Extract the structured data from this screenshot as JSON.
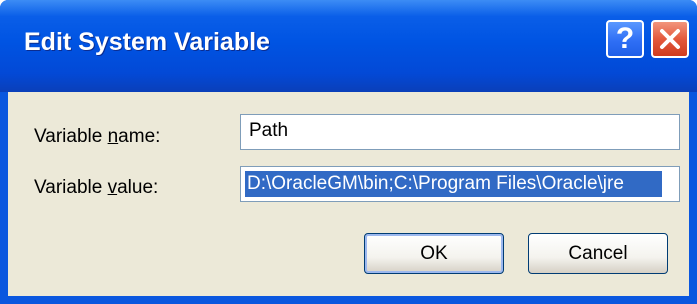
{
  "window": {
    "title": "Edit System Variable"
  },
  "titlebar_buttons": {
    "help_glyph": "?",
    "close_icon": "close-icon"
  },
  "variable_name": {
    "label": "Variable name:",
    "mnemonic": "n",
    "value": "Path"
  },
  "variable_value": {
    "label": "Variable value:",
    "mnemonic": "v",
    "value": "D:\\OracleGM\\bin;C:\\Program Files\\Oracle\\jre"
  },
  "buttons": {
    "ok": "OK",
    "cancel": "Cancel"
  },
  "colors": {
    "title_blue": "#0054e3",
    "dialog_face": "#ece9d8",
    "selection": "#316ac5",
    "close_red": "#e4593d"
  }
}
